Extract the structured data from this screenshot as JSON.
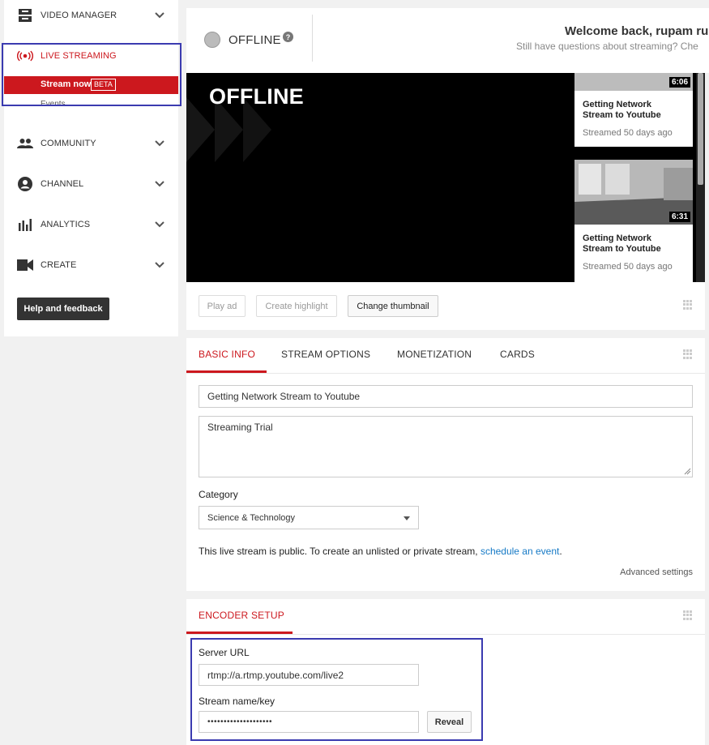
{
  "sidebar": {
    "video_manager": "VIDEO MANAGER",
    "live_streaming": "LIVE STREAMING",
    "stream_now": "Stream now",
    "beta": "BETA",
    "events": "Events",
    "community": "COMMUNITY",
    "channel": "CHANNEL",
    "analytics": "ANALYTICS",
    "create": "CREATE",
    "help": "Help and feedback"
  },
  "status": {
    "state": "OFFLINE",
    "help_glyph": "?",
    "welcome": "Welcome back, rupam rup",
    "sub": "Still have questions about streaming? Che"
  },
  "player": {
    "overlay": "OFFLINE",
    "videos": [
      {
        "duration": "6:06",
        "title": "Getting Network Stream to Youtube",
        "meta": "Streamed 50 days ago"
      },
      {
        "duration": "6:31",
        "title": "Getting Network Stream to Youtube",
        "meta": "Streamed 50 days ago"
      }
    ],
    "buttons": {
      "play_ad": "Play ad",
      "create_highlight": "Create highlight",
      "change_thumbnail": "Change thumbnail"
    }
  },
  "info": {
    "tabs": [
      "BASIC INFO",
      "STREAM OPTIONS",
      "MONETIZATION",
      "CARDS"
    ],
    "title_value": "Getting Network Stream to Youtube",
    "description_value": "Streaming Trial",
    "category_label": "Category",
    "category_value": "Science & Technology",
    "public_text": "This live stream is public. To create an unlisted or private stream, ",
    "public_link": "schedule an event",
    "public_end": ".",
    "advanced": "Advanced settings"
  },
  "encoder": {
    "tab": "ENCODER SETUP",
    "server_label": "Server URL",
    "server_value": "rtmp://a.rtmp.youtube.com/live2",
    "key_label": "Stream name/key",
    "key_value": "••••••••••••••••••••",
    "reveal": "Reveal"
  },
  "colors": {
    "accent": "#cc181e",
    "highlight": "#3b3bb0",
    "link": "#167ac6"
  }
}
